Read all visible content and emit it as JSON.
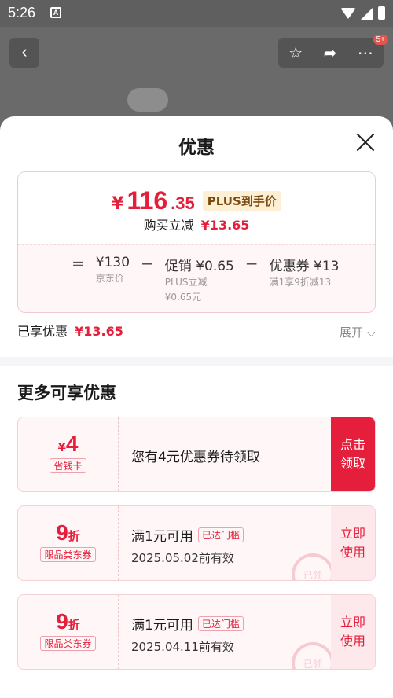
{
  "status_bar": {
    "time": "5:26",
    "app_icon": "A"
  },
  "header": {
    "badge": "5+"
  },
  "sheet": {
    "title": "优惠",
    "summary": {
      "currency": "¥",
      "price_int": "116",
      "price_dec": ".35",
      "plus_tag": "PLUS到手价",
      "reduce_label": "购买立减",
      "reduce_amount": "¥13.65",
      "calc": {
        "equals": "=",
        "jd_price": "¥130",
        "jd_price_label": "京东价",
        "minus1": "−",
        "promo": "促销 ¥0.65",
        "promo_sub1": "PLUS立减",
        "promo_sub2": "¥0.65元",
        "minus2": "−",
        "coupon": "优惠券 ¥13",
        "coupon_sub": "满1享9折减13"
      }
    },
    "enjoyed_label": "已享优惠",
    "enjoyed_amount": "¥13.65",
    "expand_label": "展开 ⌵",
    "more_title": "更多可享优惠",
    "coupons": [
      {
        "currency": "¥",
        "value": "4",
        "tag": "省钱卡",
        "desc": "您有4元优惠券待领取",
        "action_line1": "点击",
        "action_line2": "领取"
      },
      {
        "value": "9",
        "unit": "折",
        "tag": "限品类东券",
        "cond": "满1元可用",
        "threshold": "已达门槛",
        "expiry": "2025.05.02前有效",
        "action_line1": "立即",
        "action_line2": "使用",
        "stamp": "已领"
      },
      {
        "value": "9",
        "unit": "折",
        "tag": "限品类东券",
        "cond": "满1元可用",
        "threshold": "已达门槛",
        "expiry": "2025.04.11前有效",
        "action_line1": "立即",
        "action_line2": "使用",
        "stamp": "已领"
      }
    ]
  }
}
